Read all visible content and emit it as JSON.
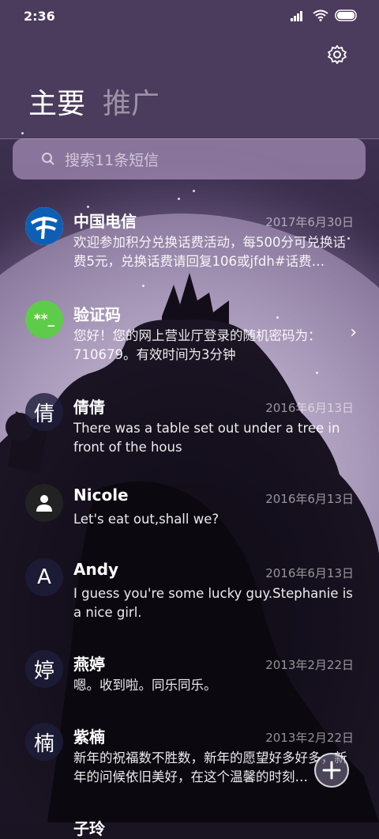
{
  "status_bar": {
    "time": "2:36"
  },
  "tabs": [
    {
      "label": "主要",
      "active": true
    },
    {
      "label": "推广",
      "active": false
    }
  ],
  "search": {
    "placeholder": "搜索11条短信"
  },
  "conversations": [
    {
      "name": "中国电信",
      "date": "2017年6月30日",
      "message": "欢迎参加积分兑换话费活动，每500分可兑换话费5元，兑换话费请回复106或jfdh#话费…",
      "avatar_type": "china-telecom-logo"
    },
    {
      "name": "验证码",
      "date": "",
      "message": "您好！您的网上营业厅登录的随机密码为：710679。有效时间为3分钟",
      "avatar_type": "verification-code-badge",
      "avatar_text": "**_"
    },
    {
      "name": "倩倩",
      "date": "2016年6月13日",
      "message": "There was a table set out under a tree in front of the hous",
      "avatar_text": "倩"
    },
    {
      "name": "Nicole",
      "date": "2016年6月13日",
      "message": "Let's eat out,shall we?",
      "avatar_type": "person-icon"
    },
    {
      "name": "Andy",
      "date": "2016年6月13日",
      "message": "I guess you're some lucky guy.Stephanie is a nice girl.",
      "avatar_text": "A"
    },
    {
      "name": "燕婷",
      "date": "2013年2月22日",
      "message": "嗯。收到啦。同乐同乐。",
      "avatar_text": "婷"
    },
    {
      "name": "紫楠",
      "date": "2013年2月22日",
      "message": "新年的祝福数不胜数，新年的愿望好多好多，新年的问候依旧美好，在这个温馨的时刻…",
      "avatar_text": "楠"
    },
    {
      "name": "子玲",
      "date": "",
      "message": "",
      "avatar_text": ""
    }
  ],
  "colors": {
    "header_bg": "#4b3b5d",
    "search_bg": "#c8afdc",
    "verify_green": "#5ecb4a"
  },
  "icons": {
    "settings": "gear-icon",
    "search": "search-icon",
    "fab": "plus-icon",
    "chevron": "chevron-right-icon"
  }
}
